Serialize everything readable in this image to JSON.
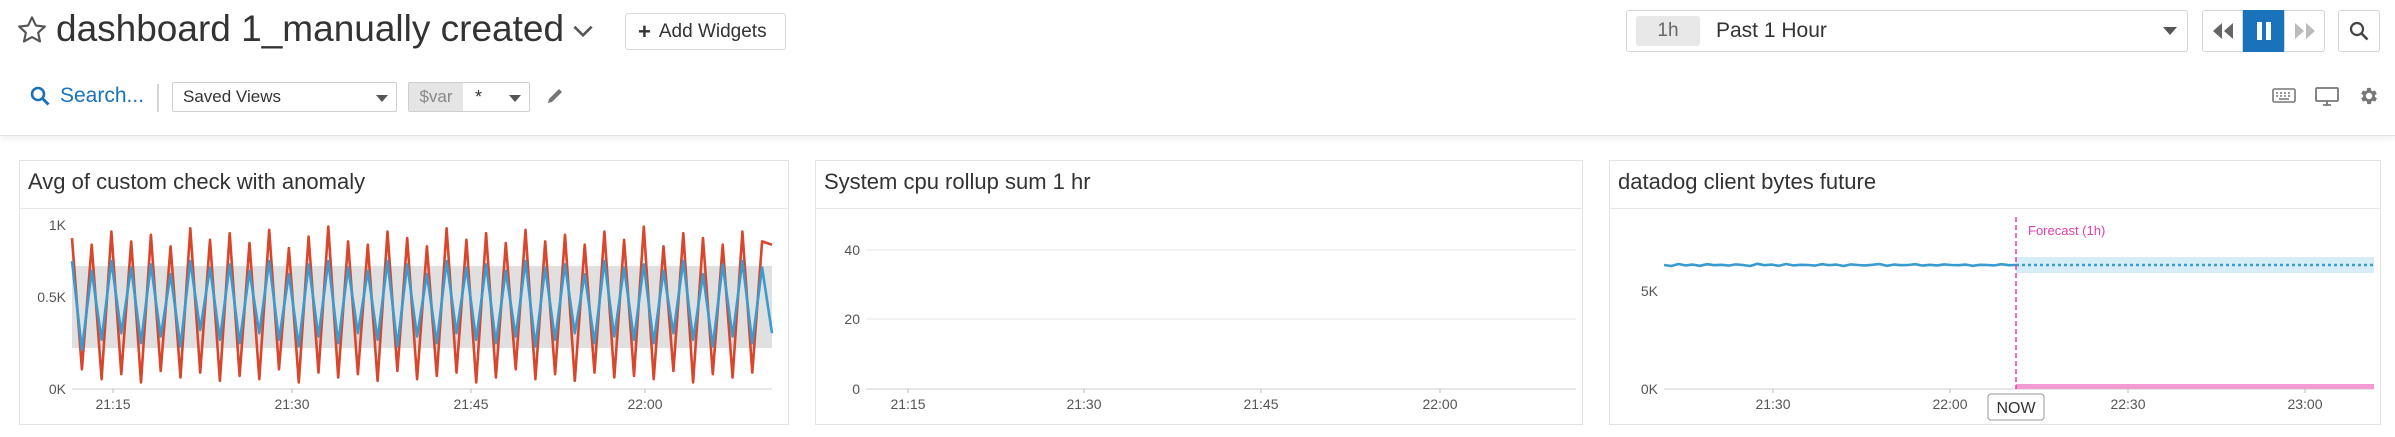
{
  "header": {
    "title": "dashboard 1_manually created",
    "add_widgets_label": "Add Widgets"
  },
  "timepicker": {
    "badge": "1h",
    "label": "Past 1 Hour"
  },
  "toolbar": {
    "search_label": "Search...",
    "saved_views_label": "Saved Views",
    "var_name": "$var",
    "var_value": "*"
  },
  "icons": [
    "star-icon",
    "chevron-down-icon",
    "plus-icon",
    "caret-down-icon",
    "rewind-icon",
    "pause-icon",
    "fast-forward-icon",
    "search-icon",
    "pencil-icon",
    "keyboard-icon",
    "monitor-icon",
    "gear-icon"
  ],
  "colors": {
    "accent": "#1a72bb",
    "anomaly": "#d9462b",
    "series": "#3a9bd0",
    "band": "#e0e0e0",
    "forecast": "#e23fa8"
  },
  "widgets": [
    {
      "title": "Avg of custom check with anomaly",
      "chart_data": {
        "type": "line",
        "title": "Avg of custom check with anomaly",
        "y_ticks": [
          "1K",
          "0.5K",
          "0K"
        ],
        "x_ticks": [
          "21:15",
          "21:30",
          "21:45",
          "22:00"
        ],
        "ylim": [
          0,
          1000
        ],
        "band_range": [
          250,
          750
        ],
        "series": [
          {
            "color": "#3a9bd0",
            "values": [
              780,
              240,
              720,
              300,
              780,
              340,
              740,
              280,
              760,
              320,
              700,
              260,
              780,
              360,
              740,
              300,
              760,
              280,
              720,
              340,
              780,
              300,
              700,
              260,
              760,
              320,
              780,
              280,
              740,
              340,
              720,
              300,
              780,
              260,
              760,
              320,
              700,
              280,
              780,
              340,
              740,
              300,
              760,
              280,
              720,
              320,
              780,
              260,
              740,
              300,
              760,
              340,
              700,
              280,
              780,
              320,
              740,
              300,
              760,
              280,
              720,
              340,
              780,
              300,
              700,
              260,
              760,
              320,
              780,
              280,
              740,
              340
            ]
          },
          {
            "color": "#d9462b",
            "values": [
              920,
              120,
              880,
              60,
              960,
              90,
              900,
              40,
              940,
              110,
              870,
              70,
              980,
              100,
              910,
              50,
              950,
              80,
              890,
              60,
              970,
              120,
              860,
              40,
              930,
              100,
              990,
              70,
              900,
              90,
              880,
              50,
              960,
              110,
              920,
              60,
              870,
              80,
              980,
              100,
              910,
              40,
              950,
              70,
              890,
              120,
              970,
              60,
              900,
              90,
              940,
              50,
              880,
              100,
              960,
              70,
              910,
              80,
              990,
              60,
              870,
              110,
              950,
              40,
              920,
              90,
              880,
              70,
              960,
              100,
              900,
              880
            ]
          }
        ]
      }
    },
    {
      "title": "System cpu rollup sum 1 hr",
      "chart_data": {
        "type": "line",
        "title": "System cpu rollup sum 1 hr",
        "y_ticks": [
          "40",
          "20",
          "0"
        ],
        "x_ticks": [
          "21:15",
          "21:30",
          "21:45",
          "22:00"
        ],
        "ylim": [
          0,
          50
        ],
        "series": []
      }
    },
    {
      "title": "datadog client bytes future",
      "chart_data": {
        "type": "line",
        "title": "datadog client bytes future",
        "y_ticks": [
          "5K",
          "0K"
        ],
        "x_ticks": [
          "21:30",
          "22:00",
          "22:30",
          "23:00"
        ],
        "ylim": [
          0,
          8000
        ],
        "forecast_label": "Forecast (1h)",
        "now_label": "NOW",
        "series": [
          {
            "color": "#3a9bd0",
            "values": [
              6200,
              6150,
              6250,
              6180,
              6220,
              6160,
              6240,
              6190,
              6210,
              6170,
              6230,
              6200,
              6150,
              6260,
              6190,
              6220,
              6160,
              6250,
              6180,
              6210,
              6200,
              6170,
              6240,
              6190,
              6220,
              6150,
              6230,
              6200,
              6180,
              6210,
              6250,
              6160,
              6220,
              6190,
              6200,
              6240,
              6170,
              6210,
              6180,
              6230,
              6200,
              6190,
              6220,
              6160,
              6210,
              6200,
              6180,
              6240,
              6190,
              6200
            ]
          }
        ],
        "forecast_value": 6200,
        "forecast_band": [
          5800,
          6600
        ]
      }
    }
  ]
}
